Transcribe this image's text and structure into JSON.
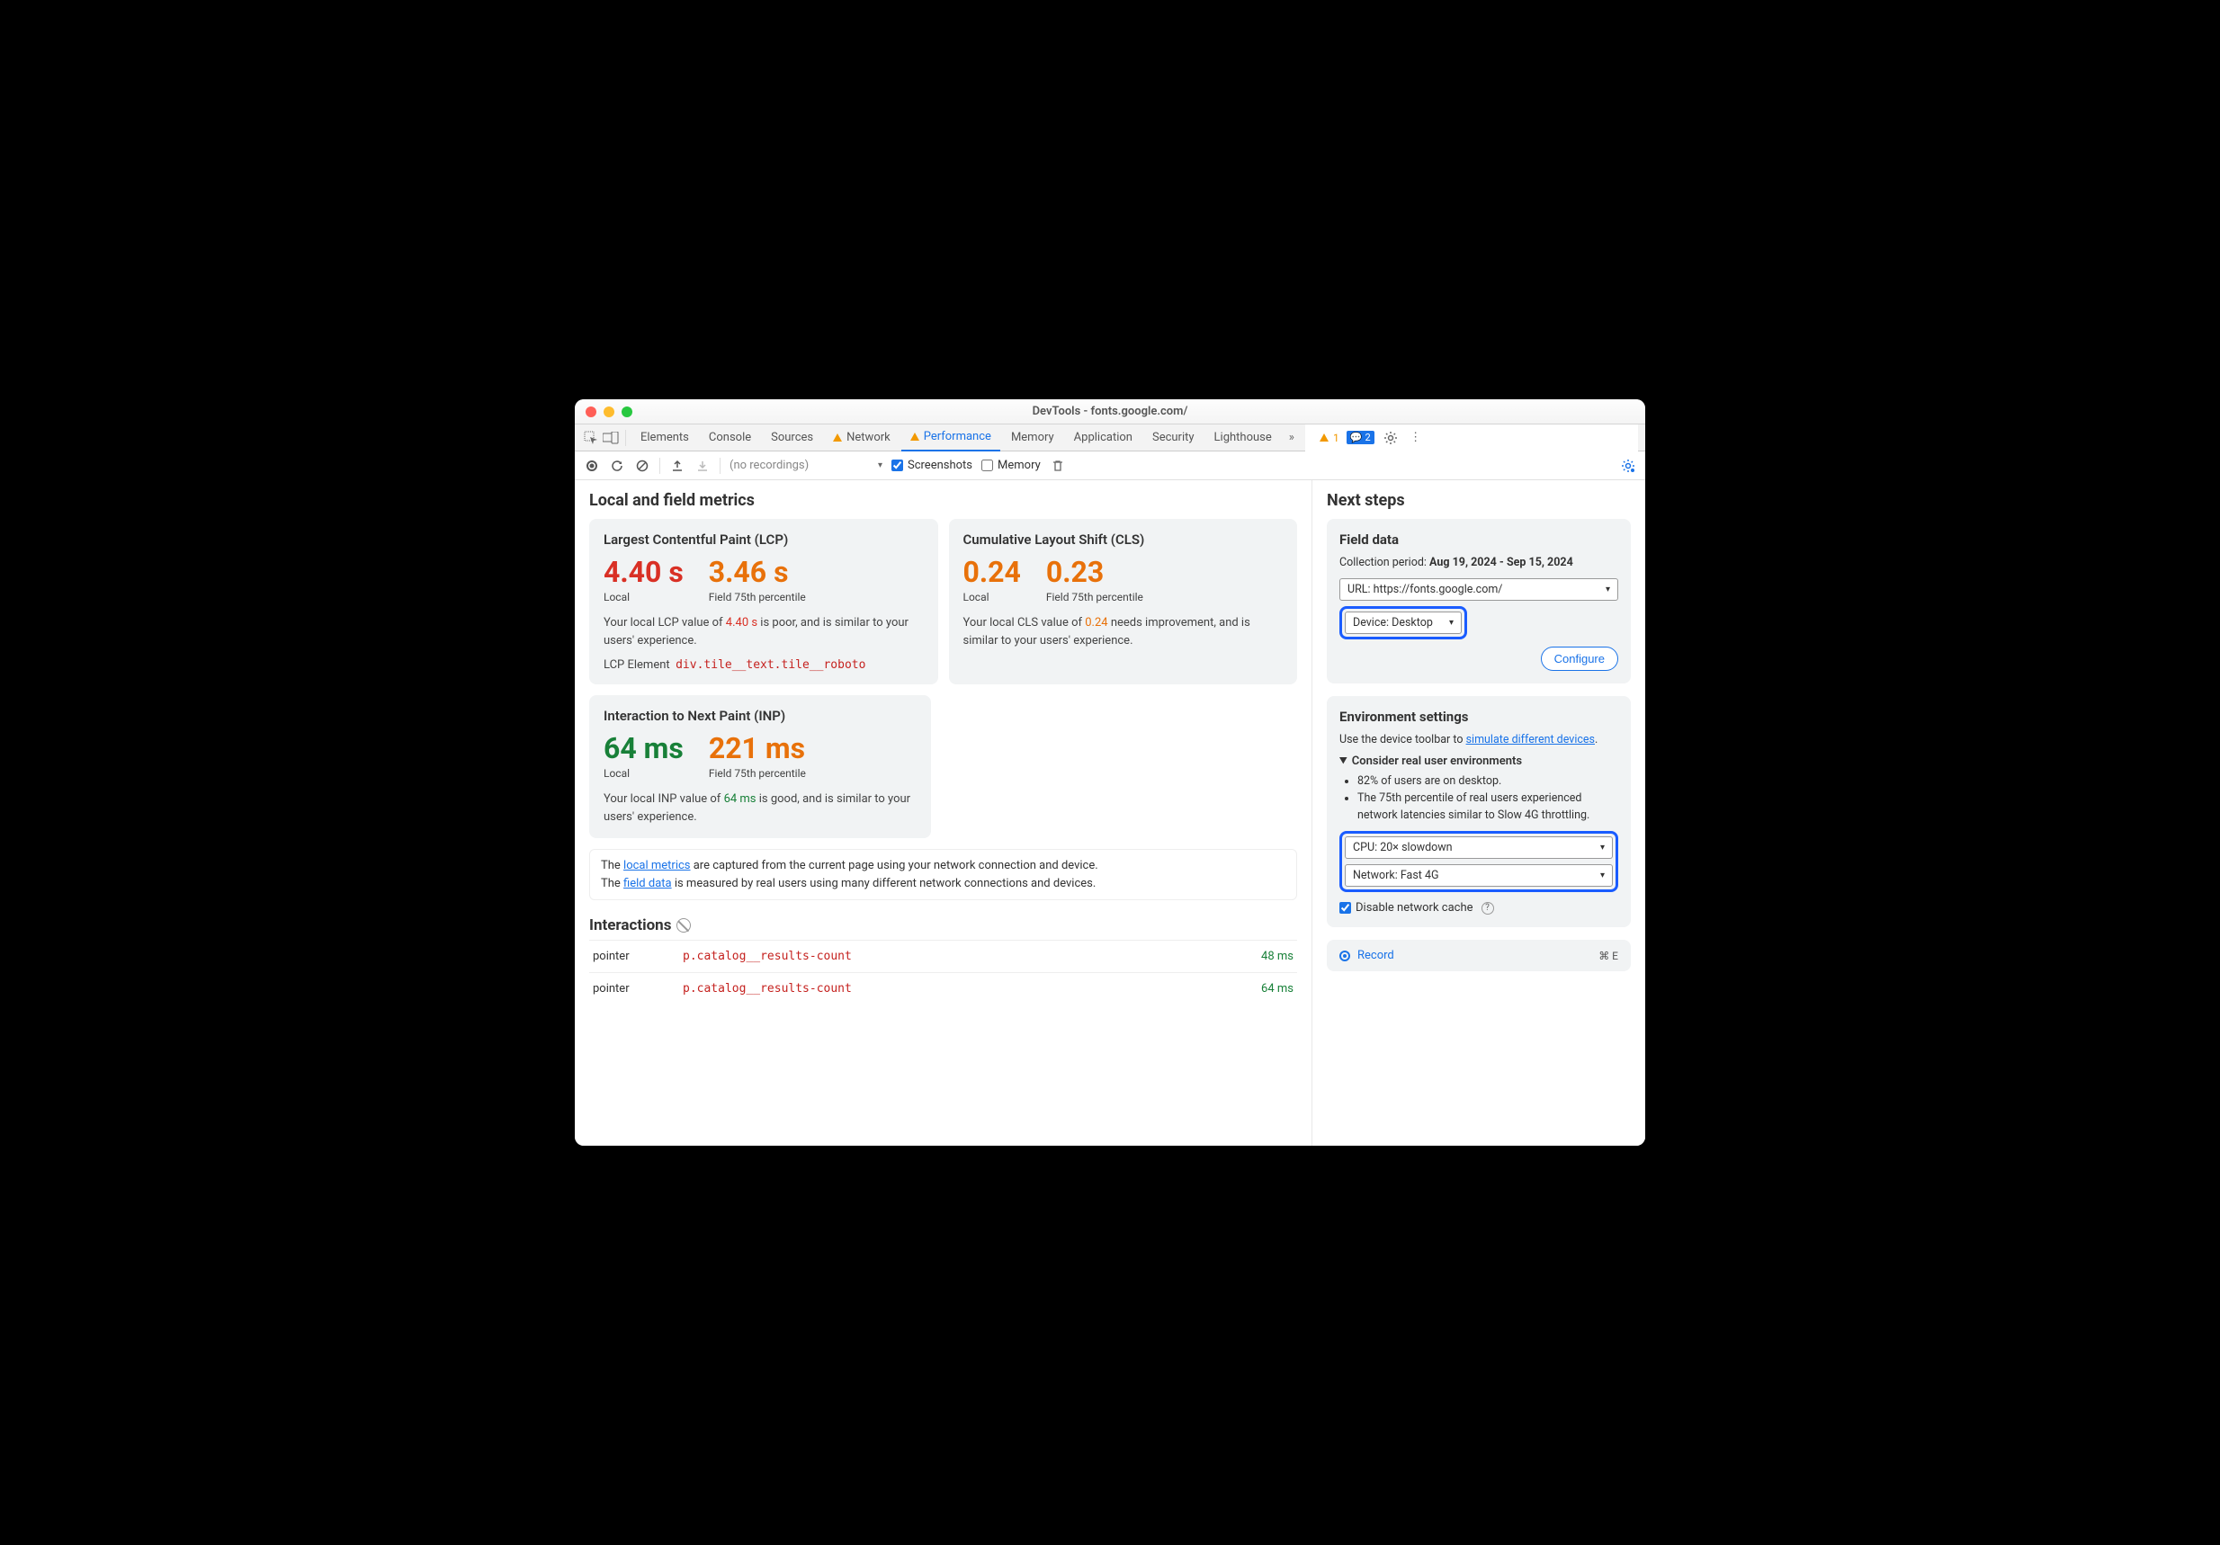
{
  "title": "DevTools - fonts.google.com/",
  "tabs": {
    "elements": "Elements",
    "console": "Console",
    "sources": "Sources",
    "network": "Network",
    "performance": "Performance",
    "memory": "Memory",
    "application": "Application",
    "security": "Security",
    "lighthouse": "Lighthouse"
  },
  "badges": {
    "warn": "1",
    "info": "2"
  },
  "toolbar": {
    "recordings": "(no recordings)",
    "screenshots": "Screenshots",
    "memory": "Memory"
  },
  "left": {
    "header": "Local and field metrics",
    "lcp": {
      "title": "Largest Contentful Paint (LCP)",
      "local_val": "4.40 s",
      "local_lbl": "Local",
      "field_val": "3.46 s",
      "field_lbl": "Field 75th percentile",
      "desc_pre": "Your local LCP value of ",
      "desc_val": "4.40 s",
      "desc_post": " is poor, and is similar to your users' experience.",
      "el_lbl": "LCP Element",
      "el_code": "div.tile__text.tile__roboto"
    },
    "cls": {
      "title": "Cumulative Layout Shift (CLS)",
      "local_val": "0.24",
      "local_lbl": "Local",
      "field_val": "0.23",
      "field_lbl": "Field 75th percentile",
      "desc_pre": "Your local CLS value of ",
      "desc_val": "0.24",
      "desc_post": " needs improvement, and is similar to your users' experience."
    },
    "inp": {
      "title": "Interaction to Next Paint (INP)",
      "local_val": "64 ms",
      "local_lbl": "Local",
      "field_val": "221 ms",
      "field_lbl": "Field 75th percentile",
      "desc_pre": "Your local INP value of ",
      "desc_val": "64 ms",
      "desc_post": " is good, and is similar to your users' experience."
    },
    "note_pre1": "The ",
    "note_link1": "local metrics",
    "note_post1": " are captured from the current page using your network connection and device.",
    "note_pre2": "The ",
    "note_link2": "field data",
    "note_post2": " is measured by real users using many different network connections and devices.",
    "interactions": {
      "title": "Interactions",
      "rows": [
        {
          "type": "pointer",
          "sel": "p.catalog__results-count",
          "ms": "48 ms"
        },
        {
          "type": "pointer",
          "sel": "p.catalog__results-count",
          "ms": "64 ms"
        }
      ]
    }
  },
  "right": {
    "header": "Next steps",
    "field": {
      "title": "Field data",
      "period_lbl": "Collection period: ",
      "period_val": "Aug 19, 2024 - Sep 15, 2024",
      "url": "URL: https://fonts.google.com/",
      "device": "Device: Desktop",
      "configure": "Configure"
    },
    "env": {
      "title": "Environment settings",
      "hint_pre": "Use the device toolbar to ",
      "hint_link": "simulate different devices",
      "consider": "Consider real user environments",
      "bullets": [
        "82% of users are on desktop.",
        "The 75th percentile of real users experienced network latencies similar to Slow 4G throttling."
      ],
      "cpu": "CPU: 20× slowdown",
      "net": "Network: Fast 4G",
      "cache": "Disable network cache"
    },
    "record": {
      "label": "Record",
      "kb": "⌘ E"
    }
  }
}
